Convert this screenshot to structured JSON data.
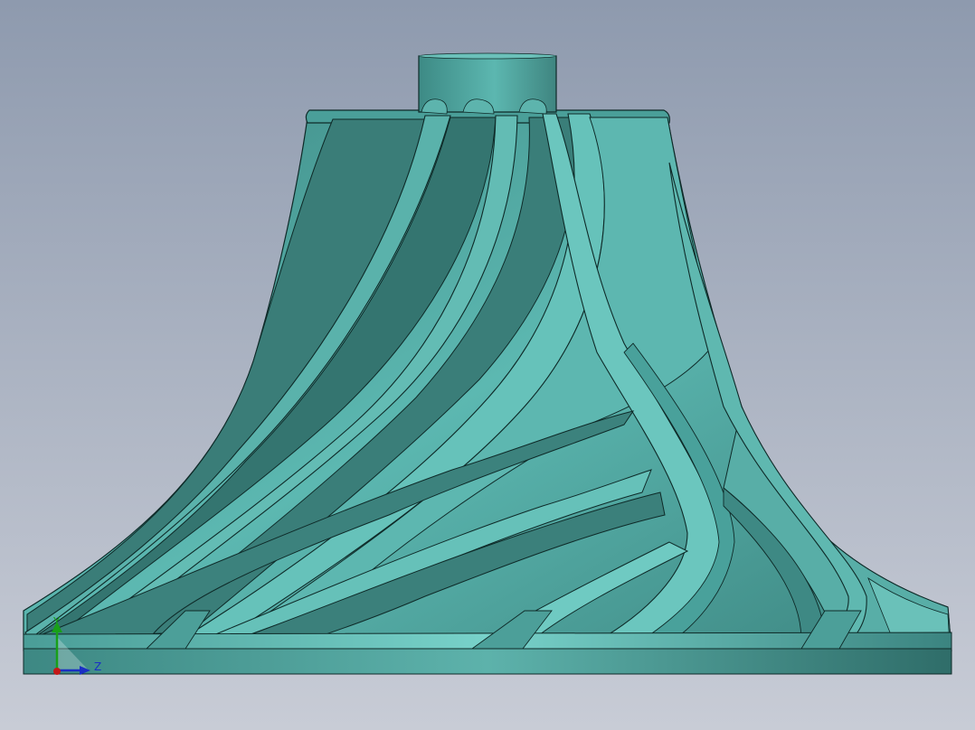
{
  "viewport": {
    "background_top": "#8e9aae",
    "background_bottom": "#c8ccd6"
  },
  "model": {
    "name": "impeller",
    "body_color": "#4fa9a3",
    "light_color": "#7fd3cc",
    "dark_color": "#2e6864",
    "edge_color": "#0e2a28"
  },
  "triad": {
    "y_axis": {
      "label": "Y",
      "color": "#18a018",
      "icon": "y-axis-arrow-icon"
    },
    "z_axis": {
      "label": "Z",
      "color": "#1a2fc4",
      "icon": "z-axis-arrow-icon"
    },
    "origin": {
      "color": "#c41818",
      "icon": "origin-dot-icon"
    }
  }
}
